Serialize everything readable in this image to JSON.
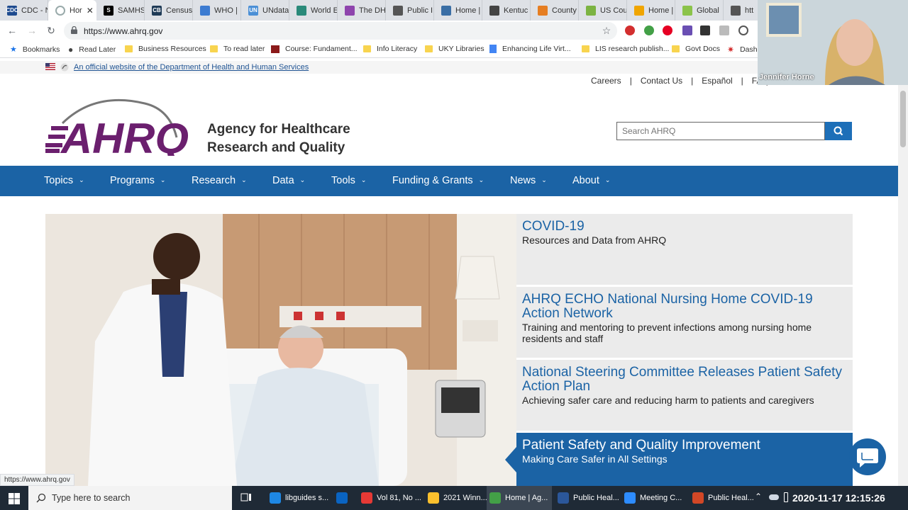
{
  "browser": {
    "tabs": [
      {
        "label": "CDC - N",
        "color": "#1e4b8f",
        "glyph": "CDC"
      },
      {
        "label": "Hor",
        "color": "#ffffff",
        "glyph": "",
        "active": true
      },
      {
        "label": "SAMHS",
        "color": "#000000",
        "glyph": "S"
      },
      {
        "label": "Census",
        "color": "#1f3b57",
        "glyph": "CB"
      },
      {
        "label": "WHO |",
        "color": "#3c7bd1",
        "glyph": ""
      },
      {
        "label": "UNdata",
        "color": "#4b8fd6",
        "glyph": "UN"
      },
      {
        "label": "World E",
        "color": "#2a8a7a",
        "glyph": ""
      },
      {
        "label": "The DH",
        "color": "#8e44ad",
        "glyph": ""
      },
      {
        "label": "Public I",
        "color": "#555555",
        "glyph": ""
      },
      {
        "label": "Home |",
        "color": "#3a6ea5",
        "glyph": ""
      },
      {
        "label": "Kentuc",
        "color": "#444444",
        "glyph": ""
      },
      {
        "label": "County",
        "color": "#e67e22",
        "glyph": ""
      },
      {
        "label": "US Cou",
        "color": "#7cb342",
        "glyph": ""
      },
      {
        "label": "Home |",
        "color": "#f0a500",
        "glyph": ""
      },
      {
        "label": "Global",
        "color": "#8bc34a",
        "glyph": ""
      },
      {
        "label": "htt",
        "color": "#555555",
        "glyph": ""
      }
    ],
    "url": "https://www.ahrq.gov",
    "bookmarks": [
      {
        "label": "Bookmarks",
        "kind": "star"
      },
      {
        "label": "Read Later",
        "kind": "globe"
      },
      {
        "label": "Business Resources",
        "kind": "folder"
      },
      {
        "label": "To read later",
        "kind": "folder"
      },
      {
        "label": "Course: Fundament...",
        "kind": "course"
      },
      {
        "label": "Info Literacy",
        "kind": "folder"
      },
      {
        "label": "UKY Libraries",
        "kind": "folder"
      },
      {
        "label": "Enhancing Life Virt...",
        "kind": "doc"
      },
      {
        "label": "LIS research publish...",
        "kind": "folder"
      },
      {
        "label": "Govt Docs",
        "kind": "folder"
      },
      {
        "label": "Dash",
        "kind": "dash"
      }
    ],
    "status_url": "https://www.ahrq.gov"
  },
  "site": {
    "gov_banner": "An official website of the Department of Health and Human Services",
    "utility_links": [
      "Careers",
      "Contact Us",
      "Español",
      "FAQ"
    ],
    "logo_text": "AHRQ",
    "agency_line1": "Agency for Healthcare",
    "agency_line2": "Research and Quality",
    "search_placeholder": "Search AHRQ",
    "nav": [
      "Topics",
      "Programs",
      "Research",
      "Data",
      "Tools",
      "Funding & Grants",
      "News",
      "About"
    ],
    "stories": [
      {
        "title": "COVID-19",
        "desc": "Resources and Data from AHRQ"
      },
      {
        "title": "AHRQ ECHO National Nursing Home COVID-19 Action Network",
        "desc": "Training and mentoring to prevent infections among nursing home residents and staff"
      },
      {
        "title": "National Steering Committee Releases Patient Safety Action Plan",
        "desc": "Achieving safer care and reducing harm to patients and caregivers"
      },
      {
        "title": "Patient Safety and Quality Improvement",
        "desc": "Making Care Safer in All Settings",
        "active": true
      }
    ]
  },
  "taskbar": {
    "search_placeholder": "Type here to search",
    "items": [
      {
        "label": "libguides s...",
        "color": "#1e88e5"
      },
      {
        "label": "",
        "color": "#0a64c2"
      },
      {
        "label": "Vol 81, No ...",
        "color": "#e53935"
      },
      {
        "label": "2021 Winn...",
        "color": "#fbc02d"
      },
      {
        "label": "Home | Ag...",
        "color": "#43a047",
        "active": true
      },
      {
        "label": "Public Heal...",
        "color": "#2b579a"
      },
      {
        "label": "Meeting C...",
        "color": "#2d8cff"
      },
      {
        "label": "Public Heal...",
        "color": "#d24726"
      }
    ],
    "clock": "2020-11-17 12:15:26"
  },
  "webcam": {
    "name": "Jennifer Horne"
  }
}
